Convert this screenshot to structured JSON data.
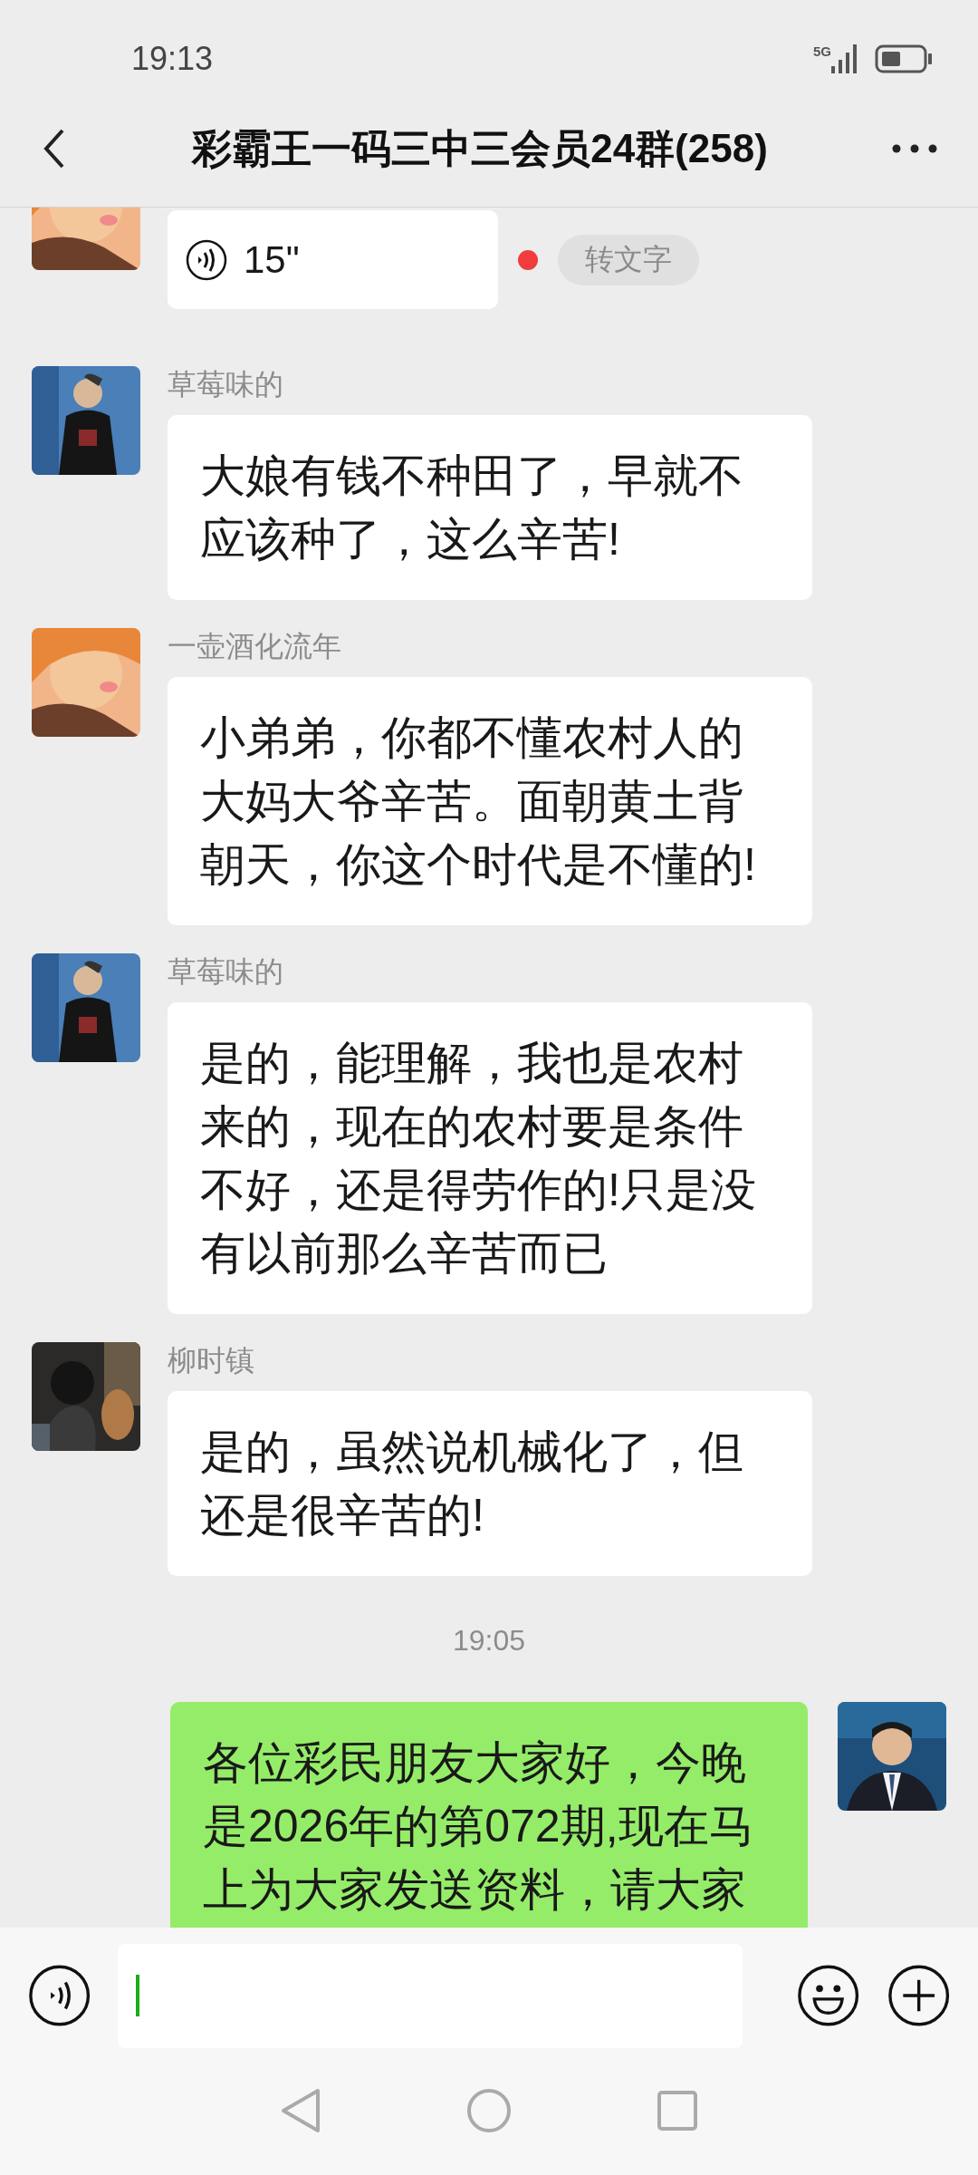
{
  "status_bar": {
    "time": "19:13",
    "network": "5G"
  },
  "header": {
    "title": "彩霸王一码三中三会员24群(258)"
  },
  "messages": [
    {
      "kind": "voice",
      "outgoing": false,
      "duration": "15\"",
      "unread": true,
      "action": "转文字"
    },
    {
      "kind": "text",
      "outgoing": false,
      "sender": "草莓味的",
      "text": "大娘有钱不种田了，早就不应该种了，这么辛苦!"
    },
    {
      "kind": "text",
      "outgoing": false,
      "sender": "一壶酒化流年",
      "text": "小弟弟，你都不懂农村人的大妈大爷辛苦。面朝黄土背朝天，你这个时代是不懂的!"
    },
    {
      "kind": "text",
      "outgoing": false,
      "sender": "草莓味的",
      "text": "是的，能理解，我也是农村来的，现在的农村要是条件不好，还是得劳作的!只是没有以前那么辛苦而已"
    },
    {
      "kind": "text",
      "outgoing": false,
      "sender": "柳时镇",
      "text": "是的，虽然说机械化了，但还是很辛苦的!"
    },
    {
      "kind": "time",
      "text": "19:05"
    },
    {
      "kind": "text",
      "outgoing": true,
      "text": "各位彩民朋友大家好，今晚是2026年的第072期,现在马上为大家发送资料，请大家"
    }
  ]
}
